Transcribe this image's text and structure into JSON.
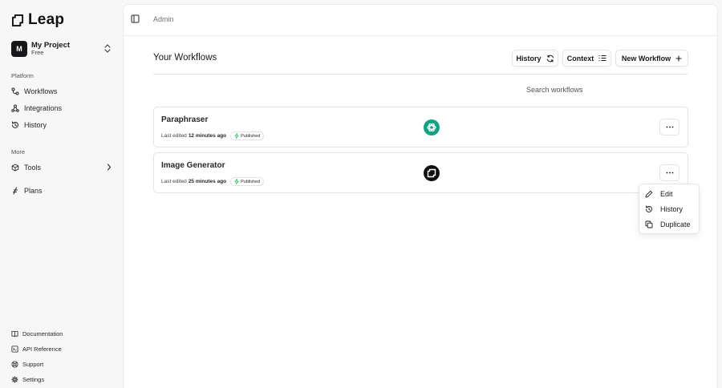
{
  "app": {
    "logo_text": "Leap"
  },
  "project": {
    "avatar": "M",
    "name": "My Project",
    "plan": "Free"
  },
  "sidebar": {
    "platform_label": "Platform",
    "platform_items": [
      {
        "label": "Workflows",
        "icon": "workflow-icon"
      },
      {
        "label": "Integrations",
        "icon": "integrations-icon"
      },
      {
        "label": "History",
        "icon": "history-icon"
      }
    ],
    "more_label": "More",
    "more_items": [
      {
        "label": "Tools",
        "icon": "tools-icon"
      },
      {
        "label": "Plans",
        "icon": "plans-icon"
      }
    ],
    "footer_items": [
      {
        "label": "Documentation",
        "icon": "book-icon"
      },
      {
        "label": "API Reference",
        "icon": "terminal-icon"
      },
      {
        "label": "Support",
        "icon": "lifebuoy-icon"
      },
      {
        "label": "Settings",
        "icon": "gear-icon"
      }
    ]
  },
  "header": {
    "breadcrumb": "Admin"
  },
  "main": {
    "title": "Your Workflows",
    "buttons": {
      "history": "History",
      "context": "Context",
      "new_workflow": "New Workflow"
    },
    "search_placeholder": "Search workflows"
  },
  "workflows": [
    {
      "name": "Paraphraser",
      "edited_prefix": "Last edited",
      "edited_time": "12 minutes ago",
      "status": "Published",
      "model_icon": "openai-icon"
    },
    {
      "name": "Image Generator",
      "edited_prefix": "Last edited",
      "edited_time": "25 minutes ago",
      "status": "Published",
      "model_icon": "image-model-icon"
    }
  ],
  "context_menu": {
    "items": [
      {
        "label": "Edit",
        "icon": "pencil-icon"
      },
      {
        "label": "History",
        "icon": "history-icon"
      },
      {
        "label": "Duplicate",
        "icon": "copy-icon"
      }
    ]
  },
  "colors": {
    "accent": "#18181b",
    "published": "#22c55e",
    "openai_bg": "#10a37f",
    "border": "#e4e4e7"
  }
}
